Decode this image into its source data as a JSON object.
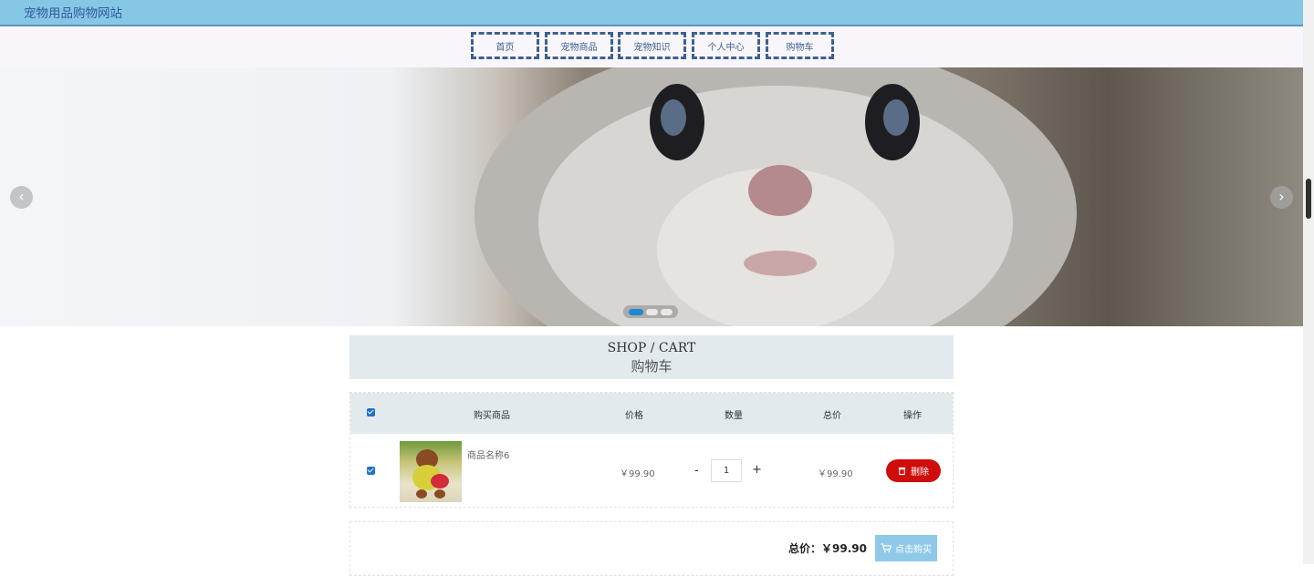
{
  "header": {
    "site_title": "宠物用品购物网站"
  },
  "nav": {
    "items": [
      {
        "label": "首页"
      },
      {
        "label": "宠物商品"
      },
      {
        "label": "宠物知识"
      },
      {
        "label": "个人中心"
      },
      {
        "label": "购物车"
      }
    ]
  },
  "banner": {
    "prev_icon": "chevron-left-icon",
    "next_icon": "chevron-right-icon",
    "prev_glyph": "‹",
    "next_glyph": "›",
    "slide_count": 3,
    "active_slide": 1
  },
  "section": {
    "title_en": "SHOP / CART",
    "title_cn": "购物车"
  },
  "cart": {
    "headers": {
      "product": "购买商品",
      "price": "价格",
      "quantity": "数量",
      "total": "总价",
      "action": "操作"
    },
    "select_all_checked": true,
    "items": [
      {
        "checked": true,
        "name": "商品名称6",
        "price": "￥99.90",
        "minus": "-",
        "quantity": "1",
        "plus": "+",
        "total": "￥99.90",
        "delete_label": "删除"
      }
    ]
  },
  "summary": {
    "total_label": "总价：",
    "total_value": "￥99.90",
    "buy_label": "点击购买"
  },
  "colors": {
    "topbar": "#87c7e6",
    "nav_border": "#3d6190",
    "delete_button": "#cf0d0d",
    "buy_button": "#8ec9ea",
    "dot_active": "#1e88d0"
  }
}
